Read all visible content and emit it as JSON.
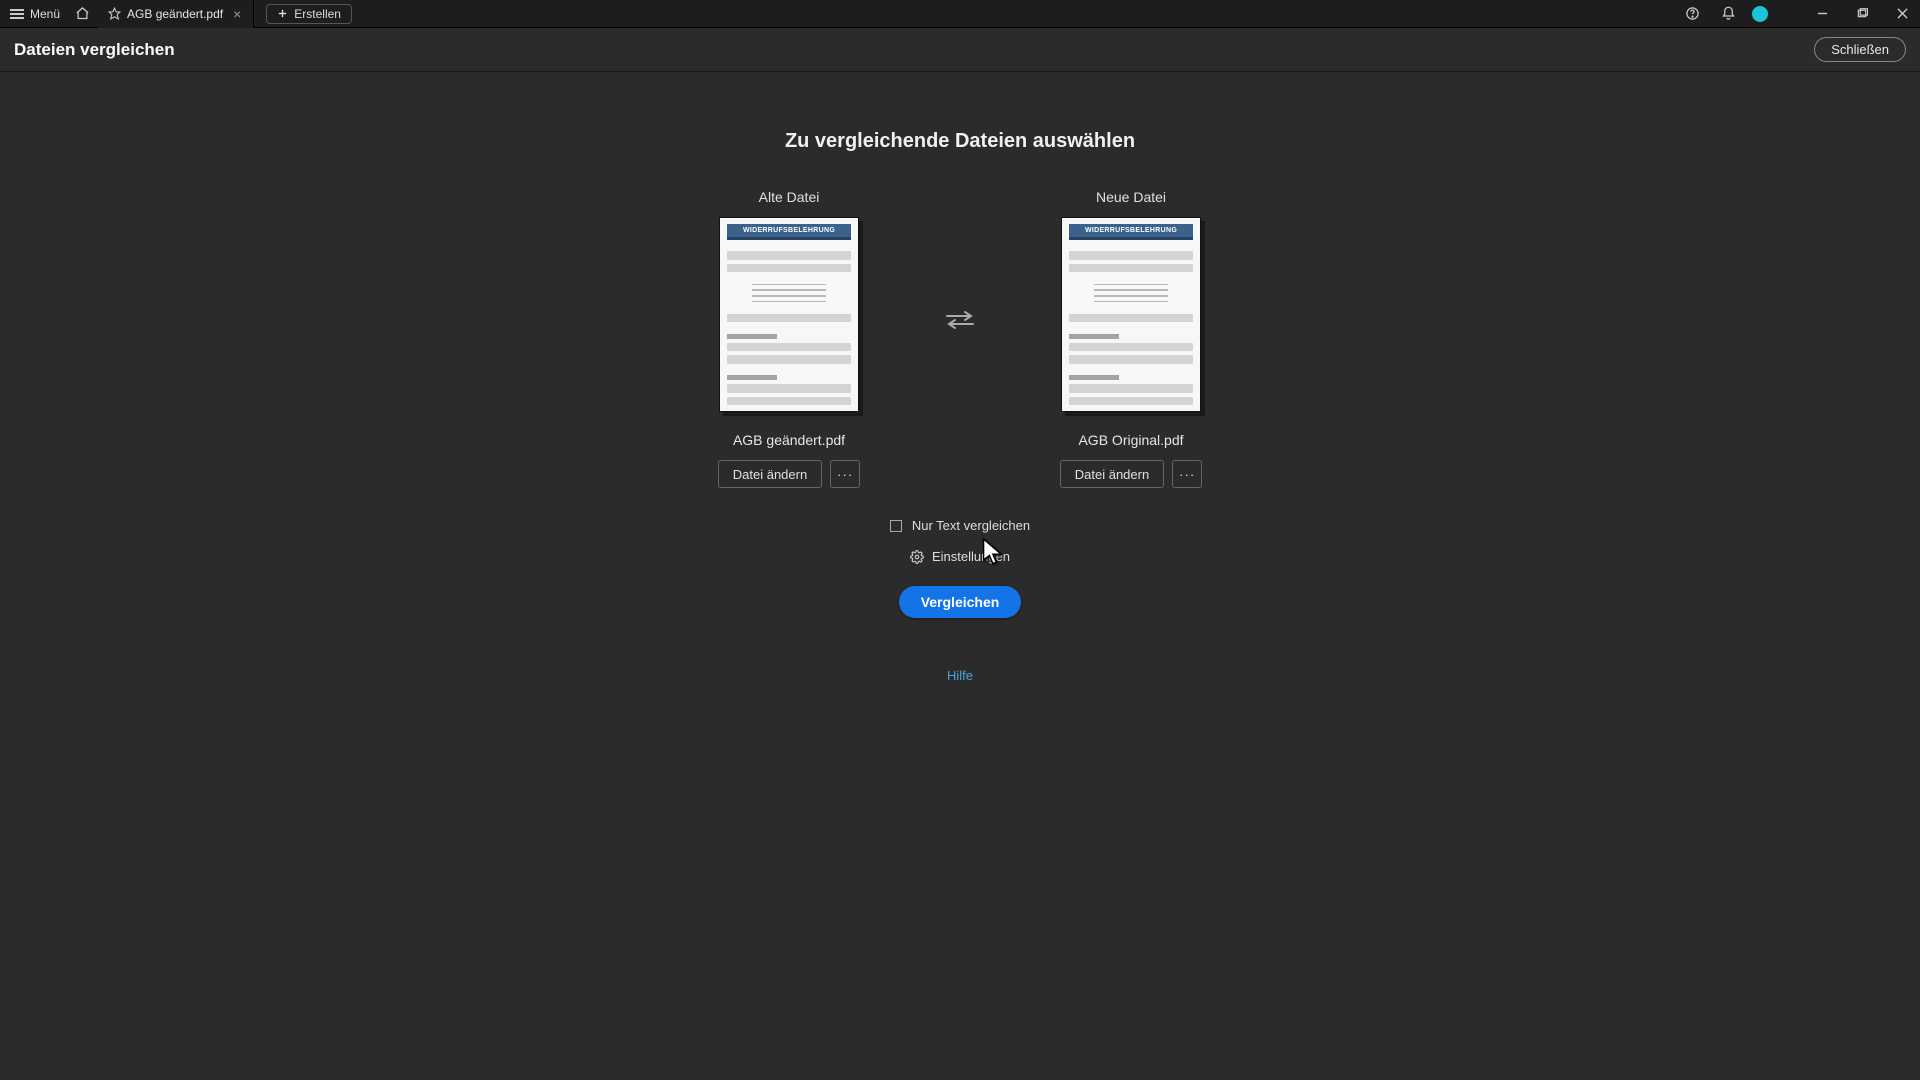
{
  "titlebar": {
    "menu_label": "Menü",
    "tab_name": "AGB geändert.pdf",
    "create_label": "Erstellen"
  },
  "toolheader": {
    "title": "Dateien vergleichen",
    "close_label": "Schließen"
  },
  "main": {
    "heading": "Zu vergleichende Dateien auswählen",
    "old_label": "Alte Datei",
    "new_label": "Neue Datei",
    "old_filename": "AGB geändert.pdf",
    "new_filename": "AGB Original.pdf",
    "thumb_banner": "WIDERRUFSBELEHRUNG",
    "change_file_label": "Datei ändern",
    "more_label": "···",
    "text_only_label": "Nur Text vergleichen",
    "settings_label": "Einstellungen",
    "compare_label": "Vergleichen",
    "help_label": "Hilfe"
  }
}
